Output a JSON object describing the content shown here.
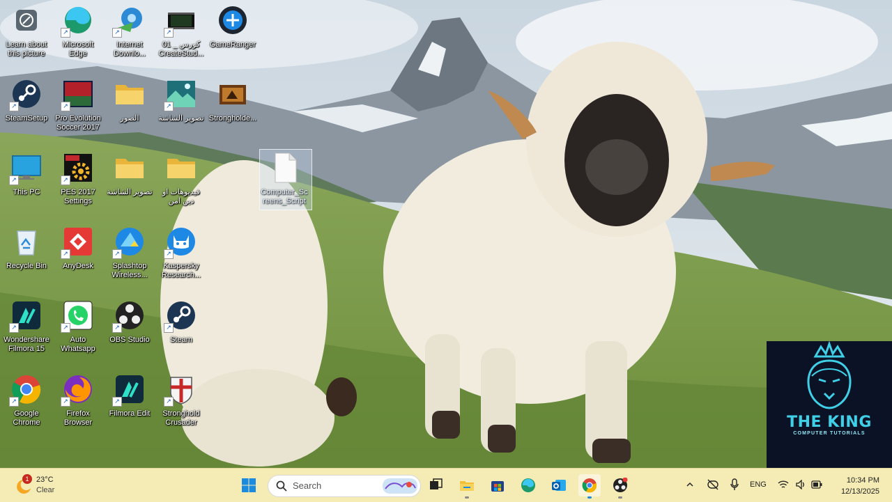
{
  "desktop": {
    "icons": [
      {
        "label": "Learn about\nthis picture",
        "icon": "info-camera-icon"
      },
      {
        "label": "Microsoft\nEdge",
        "icon": "edge-icon"
      },
      {
        "label": "Internet\nDownlo...",
        "icon": "idm-icon"
      },
      {
        "label": "01 _ كورس\nCreateStud...",
        "icon": "video-file-icon"
      },
      {
        "label": "GameRanger",
        "icon": "gameranger-icon"
      },
      {
        "label": "SteamSetup",
        "icon": "steam-icon"
      },
      {
        "label": "Pro Evolution\nSoccer 2017",
        "icon": "pes-icon"
      },
      {
        "label": "الصور",
        "icon": "folder-icon"
      },
      {
        "label": "تصوير الشاشة",
        "icon": "image-file-icon"
      },
      {
        "label": "Strongholde...",
        "icon": "stronghold-icon"
      },
      {
        "label": "This PC",
        "icon": "monitor-icon"
      },
      {
        "label": "PES 2017\nSettings",
        "icon": "settings-icon"
      },
      {
        "label": "تصوير الشاشة",
        "icon": "folder-icon"
      },
      {
        "label": "فيديوهات او\nدين امن",
        "icon": "folder-icon"
      },
      {
        "label": "Computer_Sc\nreens_Script",
        "icon": "document-icon"
      },
      {
        "label": "Recycle Bin",
        "icon": "recycle-bin-icon"
      },
      {
        "label": "AnyDesk",
        "icon": "anydesk-icon"
      },
      {
        "label": "Splashtop\nWireless...",
        "icon": "splashtop-icon"
      },
      {
        "label": "Kaspersky\nResearch...",
        "icon": "cat-app-icon"
      },
      {
        "label": "Wondershare\nFilmora 15",
        "icon": "filmora-icon"
      },
      {
        "label": "Auto\nWhatsapp",
        "icon": "whatsapp-icon"
      },
      {
        "label": "OBS Studio",
        "icon": "obs-icon"
      },
      {
        "label": "Steam",
        "icon": "steam-icon"
      },
      {
        "label": "Google\nChrome",
        "icon": "chrome-icon"
      },
      {
        "label": "Firefox\nBrowser",
        "icon": "firefox-icon"
      },
      {
        "label": "Filmora Edit",
        "icon": "filmora-icon"
      },
      {
        "label": "Stronghold\nCrusader",
        "icon": "crusader-icon"
      }
    ]
  },
  "watermark": {
    "title": "THE KING",
    "subtitle": "COMPUTER TUTORIALS",
    "background": "#0b1226",
    "accent": "#3fd0e8"
  },
  "taskbar": {
    "weather": {
      "temp": "23°C",
      "condition": "Clear",
      "badge": "1"
    },
    "search_placeholder": "Search",
    "pinned": [
      {
        "name": "start-button",
        "icon": "windows-logo-icon"
      },
      {
        "name": "task-view-button",
        "icon": "task-view-icon"
      },
      {
        "name": "file-explorer-button",
        "icon": "folder-icon"
      },
      {
        "name": "store-button",
        "icon": "store-icon"
      },
      {
        "name": "edge-button",
        "icon": "edge-icon"
      },
      {
        "name": "outlook-button",
        "icon": "outlook-icon"
      },
      {
        "name": "chrome-button",
        "icon": "chrome-icon"
      },
      {
        "name": "obs-button",
        "icon": "obs-icon"
      }
    ],
    "tray": {
      "language": "ENG",
      "time": "10:34 PM",
      "date": "12/13/2025"
    }
  }
}
